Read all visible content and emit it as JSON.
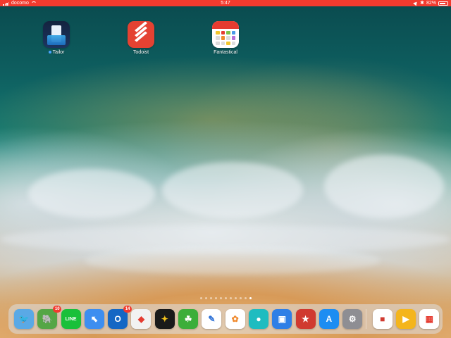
{
  "status_bar": {
    "carrier": "docomo",
    "time": "5:47",
    "battery_percent": "82%",
    "battery_level": 0.82
  },
  "home_apps": [
    {
      "name": "Tailor",
      "icon": "tailor-icon",
      "has_new_dot": true
    },
    {
      "name": "Todoist",
      "icon": "todoist-icon",
      "has_new_dot": false
    },
    {
      "name": "Fantastical",
      "icon": "fantastical-icon",
      "has_new_dot": false
    }
  ],
  "page_indicator": {
    "total": 11,
    "current": 11
  },
  "dock": {
    "apps": [
      {
        "icon": "tweetbot-icon",
        "color": "#5aa9e6",
        "badge": ""
      },
      {
        "icon": "evernote-icon",
        "color": "#55a646",
        "badge": "10"
      },
      {
        "icon": "line-icon",
        "color": "#19c03a",
        "badge": ""
      },
      {
        "icon": "safari-icon",
        "color": "#3d8ef0",
        "badge": ""
      },
      {
        "icon": "outlook-icon",
        "color": "#1467c4",
        "badge": "14"
      },
      {
        "icon": "google-maps-icon",
        "color": "#f2f2f2",
        "badge": ""
      },
      {
        "icon": "tes-icon",
        "color": "#1a1a1a",
        "badge": ""
      },
      {
        "icon": "leaf-icon",
        "color": "#3cae3a",
        "badge": ""
      },
      {
        "icon": "notes-pen-icon",
        "color": "#ffffff",
        "badge": ""
      },
      {
        "icon": "photos-icon",
        "color": "#ffffff",
        "badge": ""
      },
      {
        "icon": "mask-icon",
        "color": "#1fbcc0",
        "badge": ""
      },
      {
        "icon": "files-icon",
        "color": "#2f7fe6",
        "badge": ""
      },
      {
        "icon": "wunderlist-icon",
        "color": "#d03a30",
        "badge": ""
      },
      {
        "icon": "app-store-icon",
        "color": "#1d8df2",
        "badge": ""
      },
      {
        "icon": "settings-icon",
        "color": "#8e8e93",
        "badge": ""
      },
      {
        "icon": "reader-icon",
        "color": "#ffffff",
        "badge": ""
      },
      {
        "icon": "keynote-icon",
        "color": "#f4b51c",
        "badge": ""
      },
      {
        "icon": "fantastical-icon",
        "color": "#ffffff",
        "badge": ""
      }
    ]
  }
}
